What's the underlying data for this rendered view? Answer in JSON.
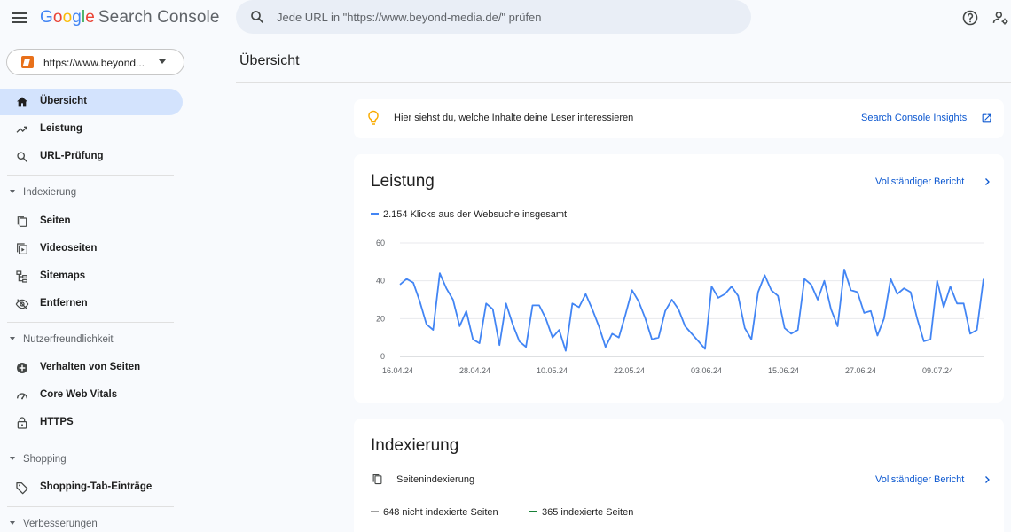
{
  "header": {
    "logo": {
      "g": "G",
      "o1": "o",
      "o2": "o",
      "g2": "g",
      "l": "l",
      "e": "e",
      "product": "Search Console"
    },
    "search_placeholder": "Jede URL in \"https://www.beyond-media.de/\" prüfen",
    "icons": [
      "menu-icon",
      "search-icon",
      "help-icon",
      "account-settings-icon"
    ]
  },
  "sidebar": {
    "property": "https://www.beyond...",
    "items_top": [
      {
        "label": "Übersicht",
        "icon": "home-icon",
        "active": true
      },
      {
        "label": "Leistung",
        "icon": "trending-up-icon"
      },
      {
        "label": "URL-Prüfung",
        "icon": "search-icon"
      }
    ],
    "sections": [
      {
        "title": "Indexierung",
        "items": [
          {
            "label": "Seiten",
            "icon": "pages-icon"
          },
          {
            "label": "Videoseiten",
            "icon": "video-pages-icon"
          },
          {
            "label": "Sitemaps",
            "icon": "sitemap-icon"
          },
          {
            "label": "Entfernen",
            "icon": "visibility-off-icon"
          }
        ]
      },
      {
        "title": "Nutzerfreundlichkeit",
        "items": [
          {
            "label": "Verhalten von Seiten",
            "icon": "add-circle-icon"
          },
          {
            "label": "Core Web Vitals",
            "icon": "speed-icon"
          },
          {
            "label": "HTTPS",
            "icon": "lock-icon"
          }
        ]
      },
      {
        "title": "Shopping",
        "items": [
          {
            "label": "Shopping-Tab-Einträge",
            "icon": "tag-icon"
          }
        ]
      },
      {
        "title": "Verbesserungen",
        "items": []
      }
    ]
  },
  "main": {
    "page_title": "Übersicht",
    "insight": {
      "text": "Hier siehst du, welche Inhalte deine Leser interessieren",
      "link": "Search Console Insights"
    },
    "performance": {
      "title": "Leistung",
      "full_report": "Vollständiger Bericht",
      "legend": "2.154 Klicks aus der Websuche insgesamt"
    },
    "indexing": {
      "title": "Indexierung",
      "full_report": "Vollständiger Bericht",
      "row_label": "Seitenindexierung",
      "not_indexed": "648 nicht indexierte Seiten",
      "indexed": "365 indexierte Seiten"
    }
  },
  "colors": {
    "accent": "#0b57d0",
    "series": "#4285f4",
    "not_indexed": "#9e9e9e",
    "indexed": "#188038",
    "active_nav": "#d3e3fd"
  },
  "chart_data": {
    "type": "line",
    "series": [
      {
        "name": "Klicks",
        "values": [
          38,
          41,
          39,
          29,
          17,
          14,
          44,
          36,
          30,
          16,
          24,
          9,
          7,
          28,
          25,
          6,
          28,
          17,
          8,
          5,
          27,
          27,
          20,
          10,
          14,
          3,
          28,
          26,
          33,
          25,
          16,
          5,
          12,
          10,
          22,
          35,
          29,
          20,
          9,
          10,
          24,
          30,
          25,
          16,
          12,
          8,
          4,
          37,
          31,
          33,
          37,
          32,
          15,
          9,
          34,
          43,
          35,
          32,
          15,
          12,
          14,
          41,
          38,
          30,
          40,
          25,
          16,
          46,
          35,
          34,
          23,
          24,
          11,
          20,
          41,
          33,
          36,
          34,
          20,
          8,
          9,
          40,
          26,
          37,
          28,
          28,
          12,
          14,
          41
        ]
      }
    ],
    "x_ticks": [
      "16.04.24",
      "28.04.24",
      "10.05.24",
      "22.05.24",
      "03.06.24",
      "15.06.24",
      "27.06.24",
      "09.07.24"
    ],
    "y_ticks": [
      "0",
      "20",
      "40",
      "60"
    ],
    "ylim": [
      0,
      60
    ],
    "grid": true
  }
}
